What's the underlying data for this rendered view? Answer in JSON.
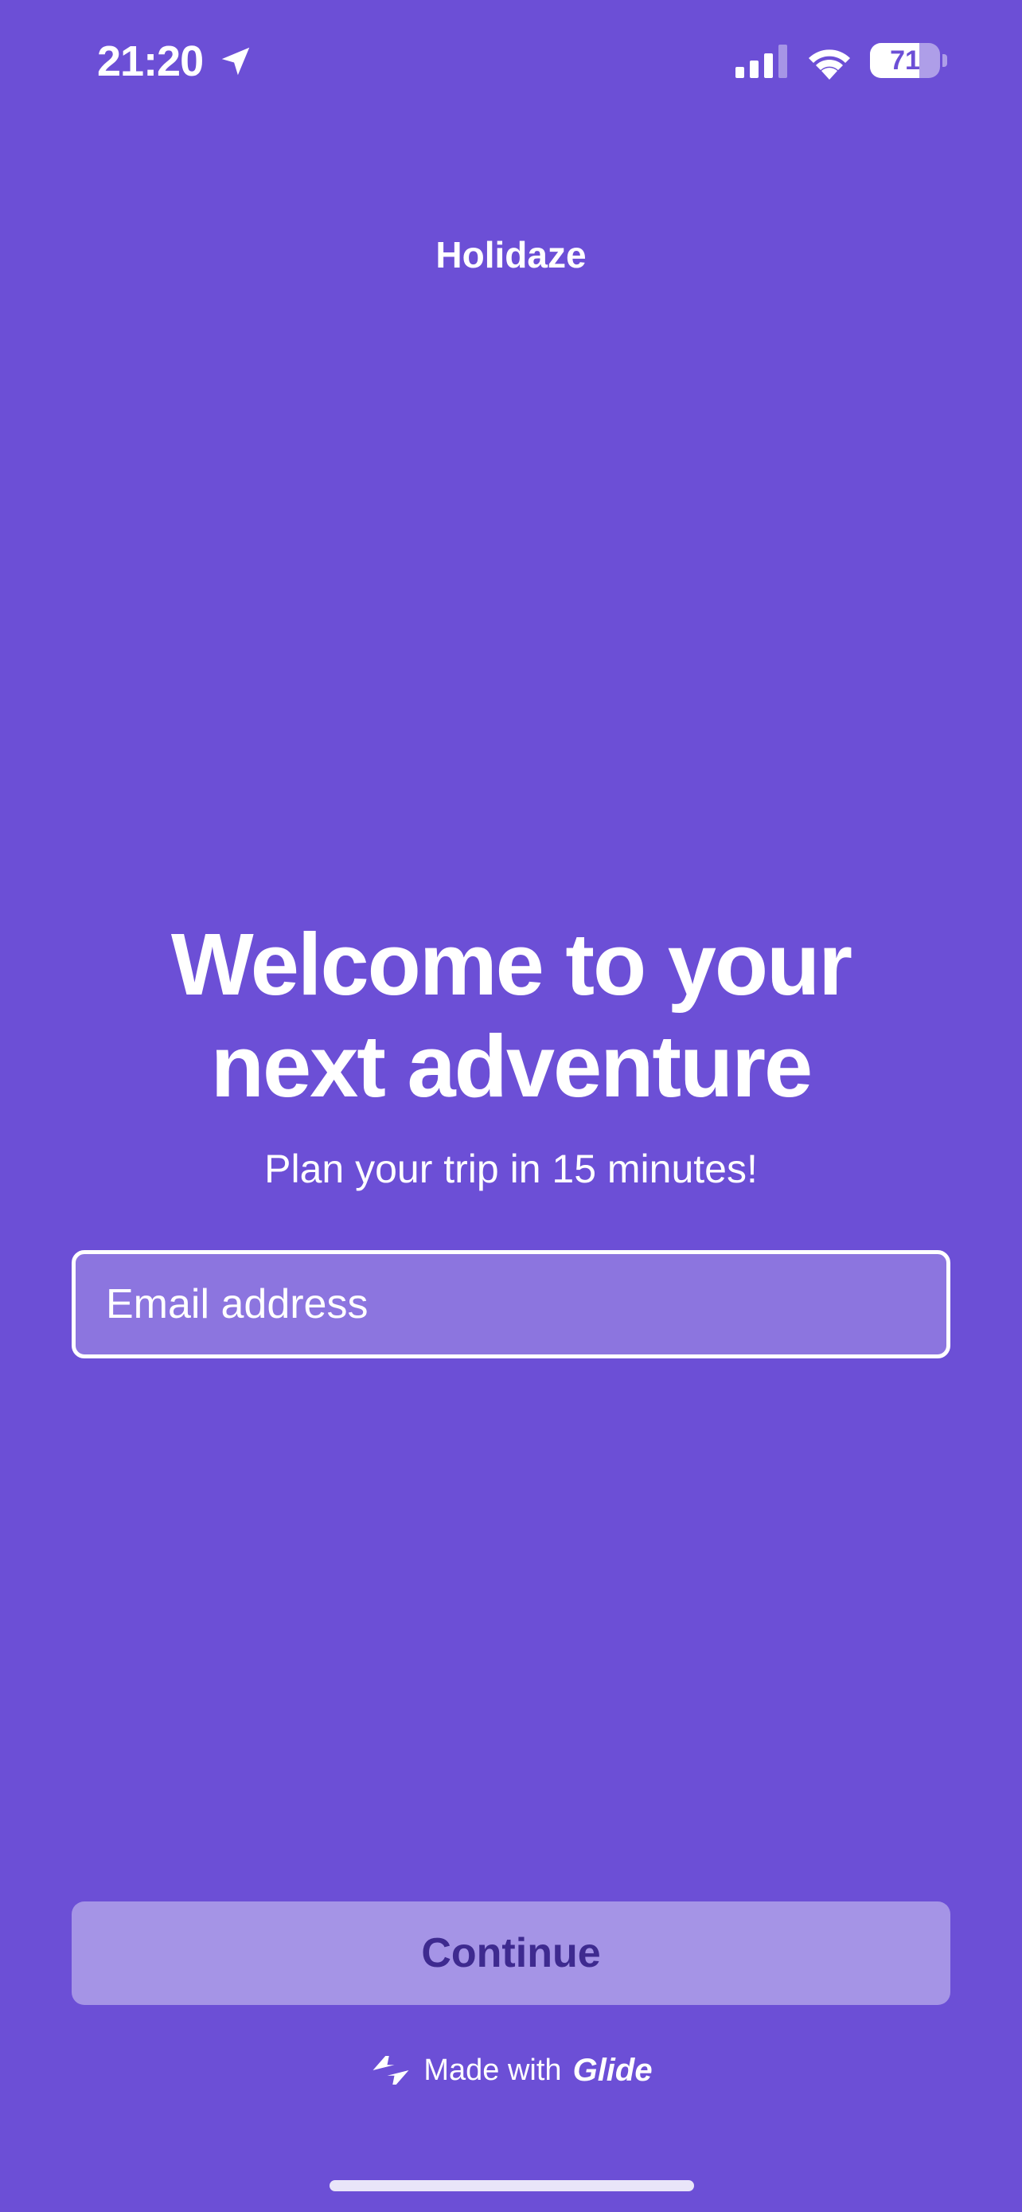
{
  "status_bar": {
    "time": "21:20",
    "battery_level": "71",
    "battery_fraction": 0.71,
    "icons": [
      "location-arrow-icon",
      "cellular-signal-icon",
      "wifi-icon",
      "battery-icon"
    ]
  },
  "header": {
    "title": "Holidaze"
  },
  "hero": {
    "headline_line1": "Welcome to your",
    "headline_line2": "next adventure",
    "subtitle": "Plan your trip in 15 minutes!"
  },
  "form": {
    "email_placeholder": "Email address",
    "email_value": "",
    "continue_label": "Continue"
  },
  "footer": {
    "made_with": "Made with",
    "brand": "Glide",
    "icon": "glide-logo-icon"
  },
  "colors": {
    "background": "#6c4fd6",
    "button": "#a594e6",
    "button_text": "#3e2a8f",
    "text": "#ffffff"
  }
}
